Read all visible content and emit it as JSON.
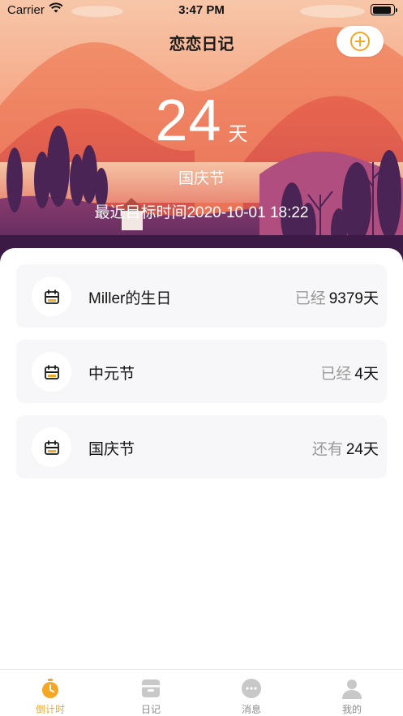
{
  "status_bar": {
    "carrier": "Carrier",
    "time": "3:47 PM"
  },
  "header": {
    "title": "恋恋日记",
    "add_icon": "plus-circle-icon"
  },
  "hero": {
    "days": "24",
    "unit": "天",
    "event_name": "国庆节",
    "target_text": "最近目标时间2020-10-01 18:22"
  },
  "events": [
    {
      "title": "Miller的生日",
      "prefix": "已经",
      "value": "9379天",
      "icon": "calendar-icon"
    },
    {
      "title": "中元节",
      "prefix": "已经",
      "value": "4天",
      "icon": "calendar-icon"
    },
    {
      "title": "国庆节",
      "prefix": "还有",
      "value": "24天",
      "icon": "calendar-icon"
    }
  ],
  "tabs": [
    {
      "label": "倒计时",
      "icon": "stopwatch-icon",
      "active": true
    },
    {
      "label": "日记",
      "icon": "diary-icon",
      "active": false
    },
    {
      "label": "消息",
      "icon": "message-icon",
      "active": false
    },
    {
      "label": "我的",
      "icon": "profile-icon",
      "active": false
    }
  ],
  "colors": {
    "accent": "#f5a623",
    "card_bg": "#f7f7f9",
    "muted_text": "#9a9a9a"
  }
}
